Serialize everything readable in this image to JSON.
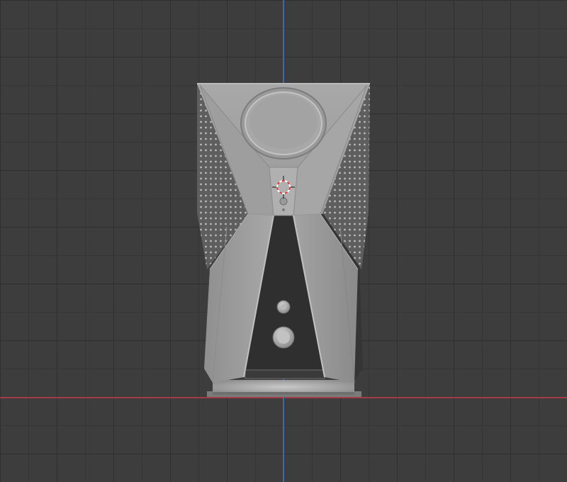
{
  "viewport": {
    "mode": "3d-orthographic-front-view",
    "grid": true
  },
  "axes": {
    "x_axis_color": "#a33a45",
    "z_axis_color": "#3d6aa3"
  },
  "object": {
    "shading": "solid",
    "base_color": "#9c9c9c",
    "dark_panel_color": "#2d2d2d"
  },
  "cursor": {
    "icon": "3d-cursor-icon",
    "ring_colors": [
      "#d63b3b",
      "#ffffff"
    ]
  }
}
